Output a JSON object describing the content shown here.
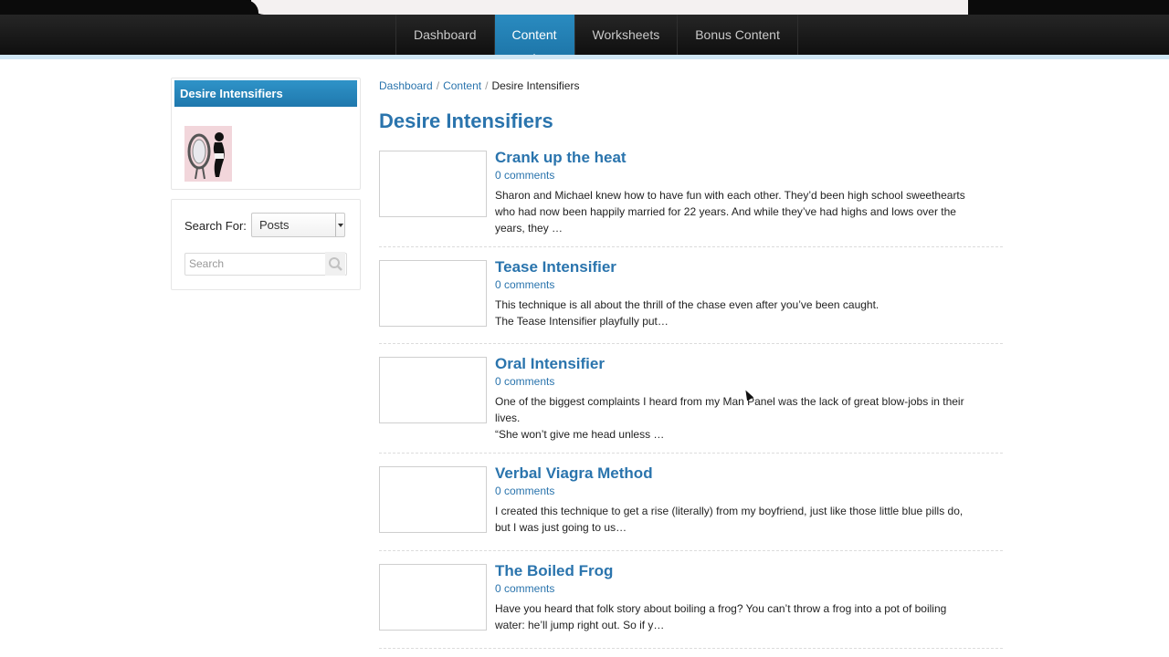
{
  "nav": {
    "items": [
      {
        "label": "Dashboard",
        "active": false
      },
      {
        "label": "Content",
        "active": true
      },
      {
        "label": "Worksheets",
        "active": false
      },
      {
        "label": "Bonus Content",
        "active": false
      }
    ]
  },
  "sidebar": {
    "category_title": "Desire Intensifiers",
    "search": {
      "label": "Search For:",
      "select_value": "Posts",
      "placeholder": "Search"
    }
  },
  "breadcrumb": {
    "items": [
      "Dashboard",
      "Content",
      "Desire Intensifiers"
    ]
  },
  "page": {
    "title": "Desire Intensifiers"
  },
  "posts": [
    {
      "title": "Crank up the heat",
      "comments": "0 comments",
      "excerpt": "Sharon and Michael knew how to have fun with each other. They’d been high school sweethearts who had now been happily married for 22 years. And while they’ve had highs and lows over the years, they …"
    },
    {
      "title": "Tease Intensifier",
      "comments": "0 comments",
      "excerpt": "This technique is all about the thrill of the chase even after you’ve been caught.",
      "excerpt2": "The Tease Intensifier playfully put…"
    },
    {
      "title": "Oral Intensifier",
      "comments": "0 comments",
      "excerpt": "One of the biggest complaints I heard from my Man Panel was the lack of great blow-jobs in their lives.",
      "excerpt2": "“She won’t give me head unless …"
    },
    {
      "title": "Verbal Viagra Method",
      "comments": "0 comments",
      "excerpt": "I created this technique to get a rise (literally) from my boyfriend, just like those little blue pills do, but I was just going to us…"
    },
    {
      "title": "The Boiled Frog",
      "comments": "0 comments",
      "excerpt": "Have you heard that folk story about boiling a frog? You can’t throw a frog into a pot of boiling water: he’ll jump right out. So if y…"
    }
  ],
  "colors": {
    "accent": "#2a74ad",
    "nav_active": "#1e77aa",
    "nav_bg": "#141414"
  }
}
